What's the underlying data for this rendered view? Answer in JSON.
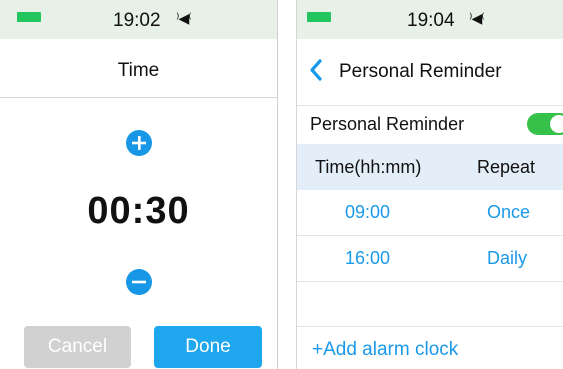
{
  "left": {
    "status": {
      "time": "19:02",
      "speaker_glyph": "⁾◀⁽"
    },
    "title": "Time",
    "value": "00:30",
    "cancel_label": "Cancel",
    "done_label": "Done"
  },
  "right": {
    "status": {
      "time": "19:04",
      "speaker_glyph": "⁾◀⁽"
    },
    "title": "Personal Reminder",
    "toggle_label": "Personal Reminder",
    "toggle_on": true,
    "table": {
      "headers": [
        "Time(hh:mm)",
        "Repeat"
      ],
      "rows": [
        [
          "09:00",
          "Once"
        ],
        [
          "16:00",
          "Daily"
        ]
      ]
    },
    "add_label": "+Add alarm clock"
  },
  "colors": {
    "accent_blue": "#1ea6ee",
    "battery_green": "#22c55e",
    "toggle_green": "#36c24a",
    "status_bg": "#e8f1e7",
    "table_header_bg": "#e4eef9",
    "disabled_gray": "#d1d1d1"
  },
  "icons": [
    "battery-icon",
    "speaker-icon",
    "plus-icon",
    "minus-icon",
    "back-chevron-icon"
  ]
}
